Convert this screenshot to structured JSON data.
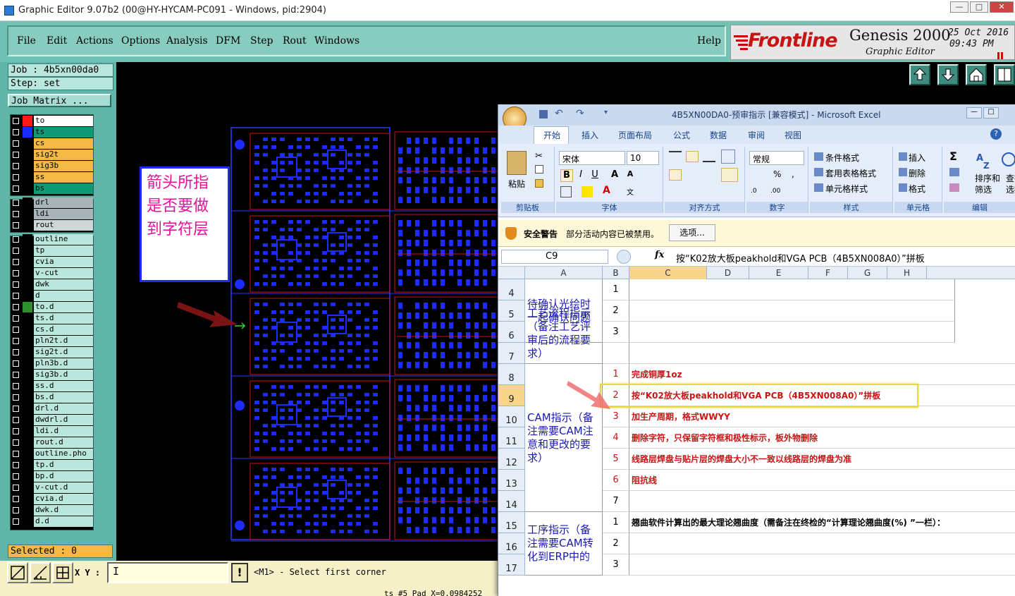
{
  "window": {
    "title": "Graphic Editor 9.07b2 (00@HY-HYCAM-PC091 - Windows, pid:2904)",
    "min": "—",
    "max": "□",
    "close": "✕"
  },
  "menu": [
    "File",
    "Edit",
    "Actions",
    "Options",
    "Analysis",
    "DFM",
    "Step",
    "Rout",
    "Windows"
  ],
  "help": "Help",
  "brand": {
    "logo": "Frontline",
    "product": "Genesis 2000",
    "subtitle": "Graphic Editor",
    "date": "25 Oct 2016",
    "time": "09:43 PM"
  },
  "job": {
    "job": "Job : 4b5xn00da0",
    "step": "Step: set",
    "matrix": "Job Matrix ...",
    "selected": "Selected : 0"
  },
  "layers_board": [
    {
      "name": "to",
      "color": "#ffffff",
      "swatch": "#ff1a1a"
    },
    {
      "name": "ts",
      "color": "#0f9a76",
      "swatch": "#1a2bff"
    },
    {
      "name": "cs",
      "color": "#f4b944",
      "swatch": "#000000"
    },
    {
      "name": "sig2t",
      "color": "#f4b944",
      "swatch": "#000000"
    },
    {
      "name": "sig3b",
      "color": "#f4b944",
      "swatch": "#000000"
    },
    {
      "name": "ss",
      "color": "#f4b944",
      "swatch": "#000000"
    },
    {
      "name": "bs",
      "color": "#0f9a76",
      "swatch": "#000000"
    }
  ],
  "layers_drill": [
    {
      "name": "drl",
      "color": "#a8b4b8"
    },
    {
      "name": "ldi",
      "color": "#a8b4b8"
    },
    {
      "name": "rout",
      "color": "#cfd6d8"
    }
  ],
  "layers_misc": [
    "outline",
    "tp",
    "cvia",
    "v-cut",
    "dwk",
    "d",
    "to.d",
    "ts.d",
    "cs.d",
    "pln2t.d",
    "sig2t.d",
    "pln3b.d",
    "sig3b.d",
    "ss.d",
    "bs.d",
    "drl.d",
    "dwdrl.d",
    "ldi.d",
    "rout.d",
    "outline.pho",
    "tp.d",
    "bp.d",
    "v-cut.d",
    "cvia.d",
    "dwk.d",
    "d.d"
  ],
  "bottom": {
    "xy_label": "X Y :",
    "xy_value": "I",
    "warn": "!",
    "prompt": "<M1> - Select first corner",
    "status": "ts #5 Pad X=0.0984252"
  },
  "annotation": {
    "text": "箭头所指是否要做到字符层",
    "lines": [
      "箭头所指",
      "是否要做",
      "到字符层"
    ]
  },
  "excel": {
    "title": "4B5XN00DA0-预审指示  [兼容模式] - Microsoft Excel",
    "tabs": [
      "开始",
      "插入",
      "页面布局",
      "公式",
      "数据",
      "审阅",
      "视图"
    ],
    "ribbon_groups": [
      "剪贴板",
      "字体",
      "对齐方式",
      "数字",
      "样式",
      "单元格",
      "编辑"
    ],
    "paste": "粘贴",
    "font_name": "宋体",
    "font_size": "10",
    "number_format": "常规",
    "styles": [
      "条件格式",
      "套用表格格式",
      "单元格样式"
    ],
    "cells_btns": [
      "插入",
      "删除",
      "格式"
    ],
    "edit_btns": [
      "排序和",
      "筛选",
      "查找",
      "选择"
    ],
    "security_label": "安全警告",
    "security_msg": "部分活动内容已被禁用。",
    "options_btn": "选项...",
    "cell_ref": "C9",
    "formula": "按“K02放大板peakhold和VGA PCB（4B5XN008A0）”拼板",
    "columns": [
      "A",
      "B",
      "C",
      "D",
      "E",
      "F",
      "G",
      "H"
    ],
    "rows": [
      {
        "n": "4",
        "b": "1",
        "c": ""
      },
      {
        "n": "5",
        "b": "2",
        "c": ""
      },
      {
        "n": "6",
        "b": "3",
        "c": ""
      },
      {
        "n": "7",
        "b": "",
        "c": ""
      },
      {
        "n": "8",
        "b": "1",
        "c": "完成铜厚1oz"
      },
      {
        "n": "9",
        "b": "2",
        "c": "按“K02放大板peakhold和VGA PCB（4B5XN008A0）”拼板"
      },
      {
        "n": "10",
        "b": "3",
        "c": "加生产周期，格式WWYY"
      },
      {
        "n": "11",
        "b": "4",
        "c": "删除字符，只保留字符框和极性标示，板外物删除"
      },
      {
        "n": "12",
        "b": "5",
        "c": "线路层焊盘与贴片层的焊盘大小不一致以线路层的焊盘为准"
      },
      {
        "n": "13",
        "b": "6",
        "c": "阻抗线"
      },
      {
        "n": "14",
        "b": "7",
        "c": ""
      },
      {
        "n": "15",
        "b": "1",
        "c": "翘曲软件计算出的最大理论翘曲度（需备注在终检的“计算理论翘曲度(%) ”一栏）："
      },
      {
        "n": "16",
        "b": "2",
        "c": ""
      },
      {
        "n": "17",
        "b": "3",
        "c": ""
      }
    ],
    "a_blocks": [
      {
        "text": "待确认光绘时一起确认问题",
        "color": "#1a1ab0"
      },
      {
        "text": "工艺流程指示（备注工艺评审后的流程要求）",
        "color": "#1a1ab0"
      },
      {
        "text": "CAM指示（备注需要CAM注意和更改的要求）",
        "color": "#1a1ab0"
      },
      {
        "text": "工序指示（备注需要CAM转化到ERP中的",
        "color": "#1a1ab0"
      }
    ]
  }
}
